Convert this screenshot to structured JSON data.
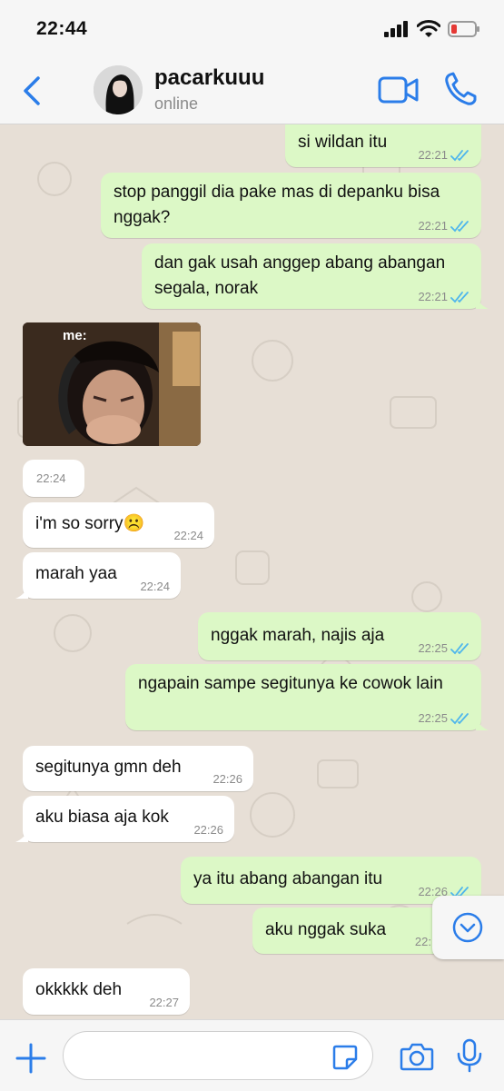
{
  "status_bar": {
    "time": "22:44"
  },
  "header": {
    "contact_name": "pacarkuuu",
    "contact_status": "online"
  },
  "image_message": {
    "caption_text": "me:"
  },
  "messages": [
    {
      "direction": "out",
      "text": "si wildan itu",
      "time": "22:21",
      "read": true
    },
    {
      "direction": "out",
      "text": "stop panggil dia pake mas di depanku bisa nggak?",
      "time": "22:21",
      "read": true
    },
    {
      "direction": "out",
      "text": "dan gak usah anggep abang abangan segala, norak",
      "time": "22:21",
      "read": true
    },
    {
      "direction": "in",
      "text": "",
      "time": "22:24"
    },
    {
      "direction": "in",
      "text": "i'm so sorry☹️",
      "time": "22:24"
    },
    {
      "direction": "in",
      "text": "marah yaa",
      "time": "22:24"
    },
    {
      "direction": "out",
      "text": "nggak marah, najis aja",
      "time": "22:25",
      "read": true
    },
    {
      "direction": "out",
      "text": "ngapain sampe segitunya ke cowok lain",
      "time": "22:25",
      "read": true
    },
    {
      "direction": "in",
      "text": "segitunya gmn deh",
      "time": "22:26"
    },
    {
      "direction": "in",
      "text": "aku biasa aja kok",
      "time": "22:26"
    },
    {
      "direction": "out",
      "text": "ya itu abang abangan itu",
      "time": "22:26",
      "read": true
    },
    {
      "direction": "out",
      "text": "aku nggak suka",
      "time": "22:",
      "read": false
    },
    {
      "direction": "in",
      "text": "okkkkk deh",
      "time": "22:27"
    }
  ],
  "colors": {
    "accent": "#2b7de9",
    "outgoing_bubble": "#dcf8c6",
    "incoming_bubble": "#ffffff",
    "read_ticks": "#4fb6ec"
  }
}
